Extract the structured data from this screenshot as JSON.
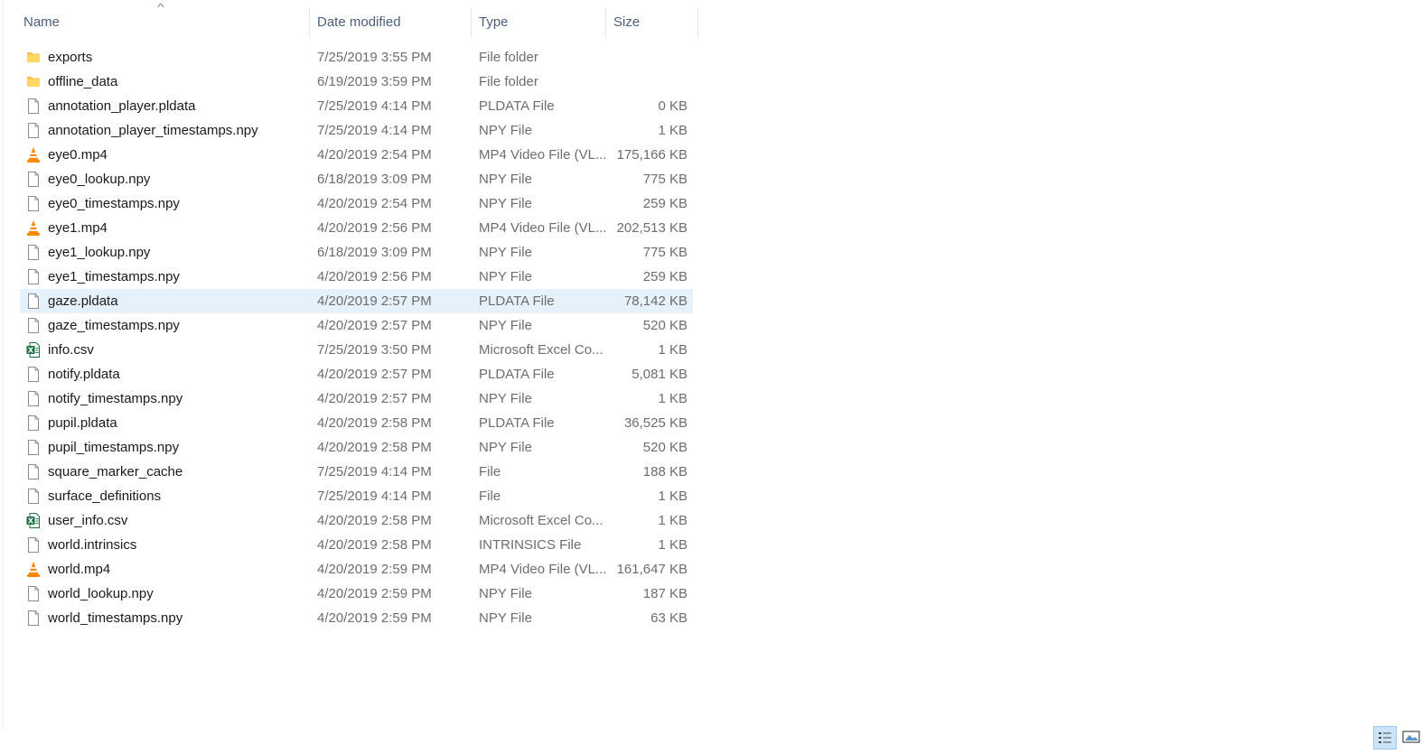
{
  "columns": {
    "name": "Name",
    "date": "Date modified",
    "type": "Type",
    "size": "Size"
  },
  "sort_indicator": "^",
  "files": [
    {
      "name": "exports",
      "date": "7/25/2019 3:55 PM",
      "type": "File folder",
      "size": "",
      "icon": "folder-icon",
      "selected": false
    },
    {
      "name": "offline_data",
      "date": "6/19/2019 3:59 PM",
      "type": "File folder",
      "size": "",
      "icon": "folder-icon",
      "selected": false
    },
    {
      "name": "annotation_player.pldata",
      "date": "7/25/2019 4:14 PM",
      "type": "PLDATA File",
      "size": "0 KB",
      "icon": "file-icon",
      "selected": false
    },
    {
      "name": "annotation_player_timestamps.npy",
      "date": "7/25/2019 4:14 PM",
      "type": "NPY File",
      "size": "1 KB",
      "icon": "file-icon",
      "selected": false
    },
    {
      "name": "eye0.mp4",
      "date": "4/20/2019 2:54 PM",
      "type": "MP4 Video File (VL...",
      "size": "175,166 KB",
      "icon": "vlc-icon",
      "selected": false
    },
    {
      "name": "eye0_lookup.npy",
      "date": "6/18/2019 3:09 PM",
      "type": "NPY File",
      "size": "775 KB",
      "icon": "file-icon",
      "selected": false
    },
    {
      "name": "eye0_timestamps.npy",
      "date": "4/20/2019 2:54 PM",
      "type": "NPY File",
      "size": "259 KB",
      "icon": "file-icon",
      "selected": false
    },
    {
      "name": "eye1.mp4",
      "date": "4/20/2019 2:56 PM",
      "type": "MP4 Video File (VL...",
      "size": "202,513 KB",
      "icon": "vlc-icon",
      "selected": false
    },
    {
      "name": "eye1_lookup.npy",
      "date": "6/18/2019 3:09 PM",
      "type": "NPY File",
      "size": "775 KB",
      "icon": "file-icon",
      "selected": false
    },
    {
      "name": "eye1_timestamps.npy",
      "date": "4/20/2019 2:56 PM",
      "type": "NPY File",
      "size": "259 KB",
      "icon": "file-icon",
      "selected": false
    },
    {
      "name": "gaze.pldata",
      "date": "4/20/2019 2:57 PM",
      "type": "PLDATA File",
      "size": "78,142 KB",
      "icon": "file-icon",
      "selected": true
    },
    {
      "name": "gaze_timestamps.npy",
      "date": "4/20/2019 2:57 PM",
      "type": "NPY File",
      "size": "520 KB",
      "icon": "file-icon",
      "selected": false
    },
    {
      "name": "info.csv",
      "date": "7/25/2019 3:50 PM",
      "type": "Microsoft Excel Co...",
      "size": "1 KB",
      "icon": "excel-icon",
      "selected": false
    },
    {
      "name": "notify.pldata",
      "date": "4/20/2019 2:57 PM",
      "type": "PLDATA File",
      "size": "5,081 KB",
      "icon": "file-icon",
      "selected": false
    },
    {
      "name": "notify_timestamps.npy",
      "date": "4/20/2019 2:57 PM",
      "type": "NPY File",
      "size": "1 KB",
      "icon": "file-icon",
      "selected": false
    },
    {
      "name": "pupil.pldata",
      "date": "4/20/2019 2:58 PM",
      "type": "PLDATA File",
      "size": "36,525 KB",
      "icon": "file-icon",
      "selected": false
    },
    {
      "name": "pupil_timestamps.npy",
      "date": "4/20/2019 2:58 PM",
      "type": "NPY File",
      "size": "520 KB",
      "icon": "file-icon",
      "selected": false
    },
    {
      "name": "square_marker_cache",
      "date": "7/25/2019 4:14 PM",
      "type": "File",
      "size": "188 KB",
      "icon": "file-icon",
      "selected": false
    },
    {
      "name": "surface_definitions",
      "date": "7/25/2019 4:14 PM",
      "type": "File",
      "size": "1 KB",
      "icon": "file-icon",
      "selected": false
    },
    {
      "name": "user_info.csv",
      "date": "4/20/2019 2:58 PM",
      "type": "Microsoft Excel Co...",
      "size": "1 KB",
      "icon": "excel-icon",
      "selected": false
    },
    {
      "name": "world.intrinsics",
      "date": "4/20/2019 2:58 PM",
      "type": "INTRINSICS File",
      "size": "1 KB",
      "icon": "file-icon",
      "selected": false
    },
    {
      "name": "world.mp4",
      "date": "4/20/2019 2:59 PM",
      "type": "MP4 Video File (VL...",
      "size": "161,647 KB",
      "icon": "vlc-icon",
      "selected": false
    },
    {
      "name": "world_lookup.npy",
      "date": "4/20/2019 2:59 PM",
      "type": "NPY File",
      "size": "187 KB",
      "icon": "file-icon",
      "selected": false
    },
    {
      "name": "world_timestamps.npy",
      "date": "4/20/2019 2:59 PM",
      "type": "NPY File",
      "size": "63 KB",
      "icon": "file-icon",
      "selected": false
    }
  ],
  "view_buttons": {
    "details": "details-view-icon",
    "thumbnails": "large-icons-view-icon"
  },
  "colors": {
    "selection": "#e5f1fb",
    "folder": "#f0c14b",
    "vlc": "#ff8800",
    "excel": "#1e7145",
    "header_text": "#4c607a"
  }
}
